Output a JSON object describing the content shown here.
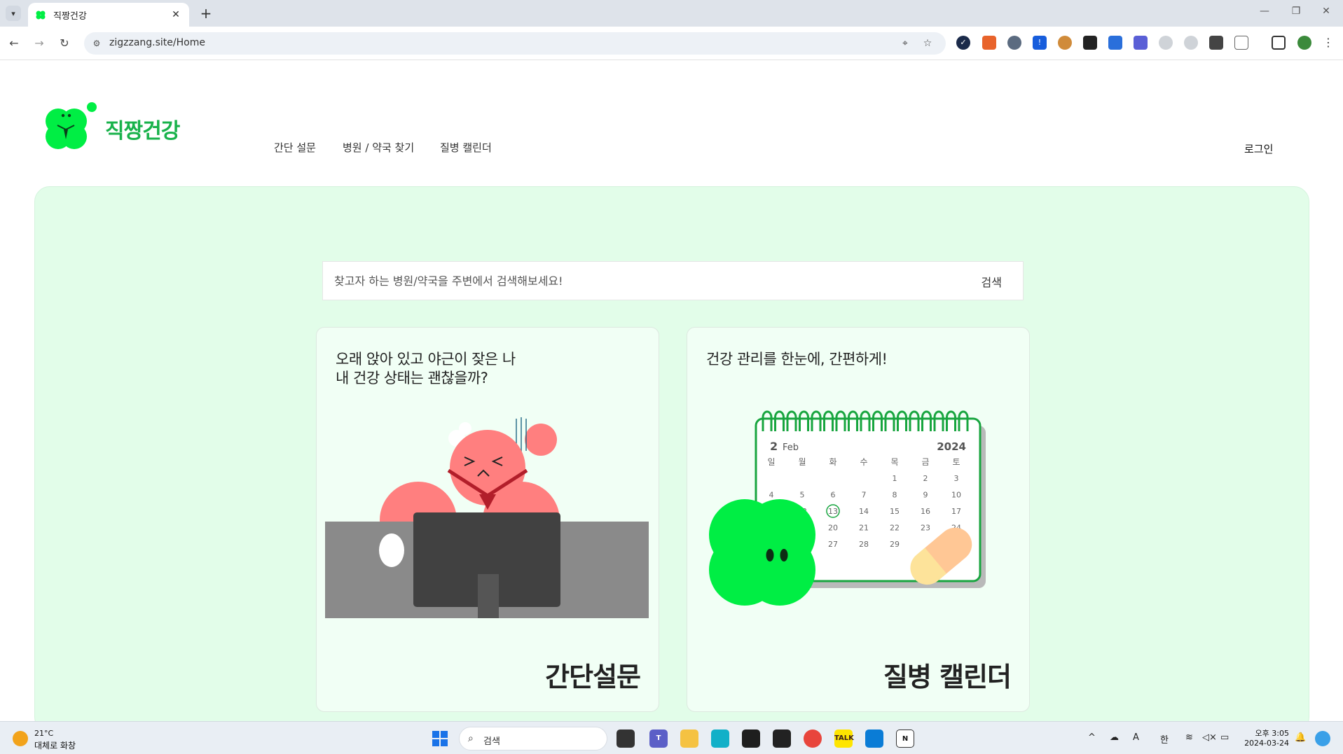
{
  "browser": {
    "tab_title": "직짱건강",
    "url": "zigzzang.site/Home"
  },
  "site": {
    "logo_text": "직짱건강",
    "nav": [
      "간단 설문",
      "병원 / 약국 찾기",
      "질병 캘린더"
    ],
    "login": "로그인"
  },
  "search": {
    "placeholder": "찾고자 하는 병원/약국을 주변에서 검색해보세요!",
    "button": "검색"
  },
  "cards": {
    "survey": {
      "desc_line1": "오래 앉아 있고 야근이 잦은 나",
      "desc_line2": "내 건강 상태는 괜찮을까?",
      "title": "간단설문"
    },
    "calendar": {
      "desc": "건강 관리를 한눈에, 간편하게!",
      "title": "질병 캘린더",
      "month_num": "2",
      "month_name": "Feb",
      "year": "2024",
      "weekdays": [
        "일",
        "월",
        "화",
        "수",
        "목",
        "금",
        "토"
      ],
      "days": [
        "1",
        "2",
        "3",
        "4",
        "5",
        "6",
        "7",
        "8",
        "9",
        "10",
        "12",
        "13",
        "14",
        "15",
        "16",
        "17",
        "20",
        "21",
        "22",
        "23",
        "24",
        "27",
        "28",
        "29"
      ],
      "highlight": "13"
    }
  },
  "taskbar": {
    "weather_temp": "21°C",
    "weather_desc": "대체로 화창",
    "search_label": "검색",
    "ime": "한",
    "font_indicator": "A",
    "time": "오후 3:05",
    "date": "2024-03-24"
  },
  "colors": {
    "brand_green": "#19b24b",
    "clover_green": "#00ee44",
    "hero_bg": "#e2fde9",
    "card_bg": "#f1fff5"
  }
}
